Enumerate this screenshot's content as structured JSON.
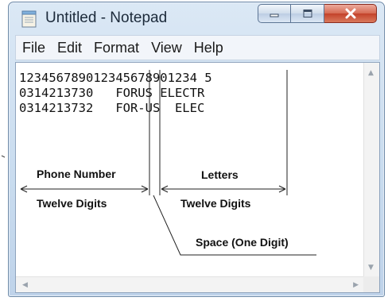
{
  "window": {
    "title": "Untitled - Notepad",
    "icons": {
      "app": "notepad-icon",
      "minimize": "minimize-icon",
      "maximize": "maximize-icon",
      "close": "close-icon"
    }
  },
  "menu": [
    "File",
    "Edit",
    "Format",
    "View",
    "Help"
  ],
  "editor": {
    "lines": [
      "123456789012345678901234 5",
      "0314213730   FORUS ELECTR",
      "0314213732   FOR-US  ELEC"
    ]
  },
  "annotations": {
    "phone_number": "Phone Number",
    "twelve_digits_left": "Twelve Digits",
    "letters": "Letters",
    "twelve_digits_right": "Twelve Digits",
    "space": "Space (One Digit)"
  }
}
